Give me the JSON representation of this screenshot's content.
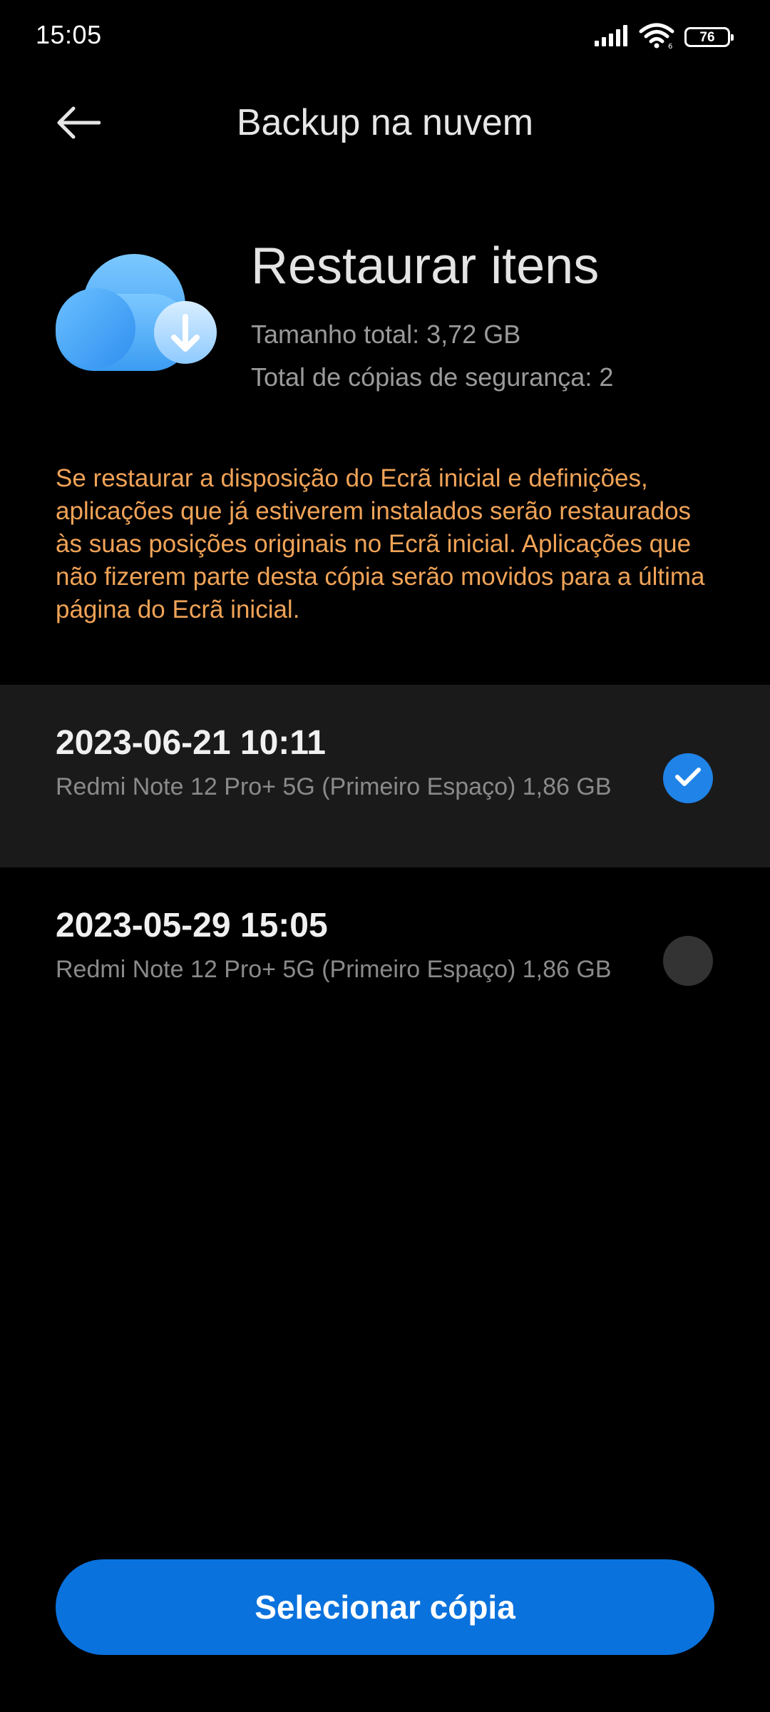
{
  "status_bar": {
    "time": "15:05",
    "battery_level": "76",
    "icons": [
      "signal-icon",
      "wifi-icon",
      "battery-icon"
    ]
  },
  "header": {
    "back_icon": "back-arrow-icon",
    "title": "Backup na nuvem"
  },
  "hero": {
    "icon": "cloud-download-icon",
    "title": "Restaurar itens",
    "total_size": "Tamanho total: 3,72 GB",
    "total_copies": "Total de cópias de segurança: 2"
  },
  "warning_text": "Se restaurar a disposição do Ecrã inicial e definições, aplicações que já estiverem instalados serão restaurados às suas posições originais no Ecrã inicial. Aplicações que não fizerem parte desta cópia serão movidos para a última página do Ecrã inicial.",
  "backups": [
    {
      "date": "2023-06-21 10:11",
      "description": "Redmi Note 12 Pro+ 5G (Primeiro Espaço) 1,86 GB",
      "selected": true
    },
    {
      "date": "2023-05-29 15:05",
      "description": "Redmi Note 12 Pro+ 5G (Primeiro Espaço) 1,86 GB",
      "selected": false
    }
  ],
  "primary_button": {
    "label": "Selecionar cópia"
  },
  "colors": {
    "background": "#000000",
    "accent": "#0a72dd",
    "radio_checked": "#1f83e8",
    "warning": "#f0a357",
    "selected_row": "#1a1a1a",
    "secondary_text": "#9a9a9a"
  }
}
